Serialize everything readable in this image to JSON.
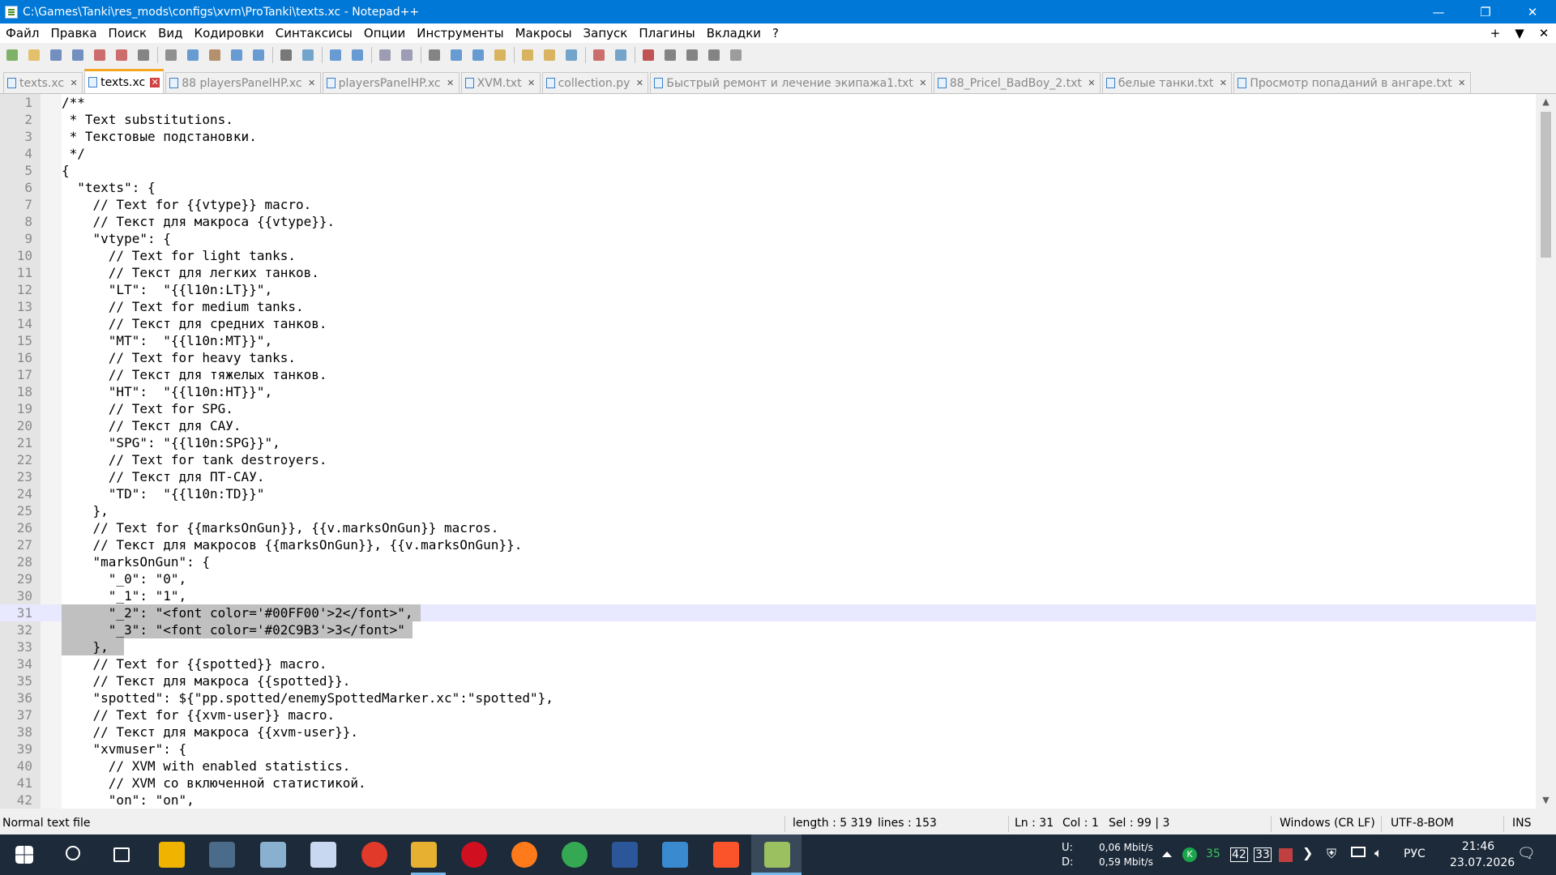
{
  "window": {
    "title": "C:\\Games\\Tanki\\res_mods\\configs\\xvm\\ProTanki\\texts.xc - Notepad++",
    "minimize": "—",
    "maximize": "❐",
    "close": "✕"
  },
  "menu": {
    "items": [
      "Файл",
      "Правка",
      "Поиск",
      "Вид",
      "Кодировки",
      "Синтаксисы",
      "Опции",
      "Инструменты",
      "Макросы",
      "Запуск",
      "Плагины",
      "Вкладки",
      "?"
    ],
    "right": [
      "+",
      "▼",
      "✕"
    ]
  },
  "toolbar": {
    "icons": [
      "new-icon",
      "open-icon",
      "save-icon",
      "save-all-icon",
      "close-icon",
      "close-all-icon",
      "print-icon",
      "cut-icon",
      "copy-icon",
      "paste-icon",
      "undo-icon",
      "redo-icon",
      "find-icon",
      "replace-icon",
      "zoom-in-icon",
      "zoom-out-icon",
      "sync-v-icon",
      "sync-h-icon",
      "wrap-icon",
      "all-chars-icon",
      "indent-guide-icon",
      "doc-map-icon",
      "function-list-icon",
      "folder-workspace-icon",
      "doc-list-icon",
      "monitor-icon",
      "eye-icon",
      "record-icon",
      "stop-icon",
      "play-icon",
      "run-multiple-icon",
      "save-macro-icon"
    ]
  },
  "tabs": [
    {
      "label": "texts.xc",
      "active": false
    },
    {
      "label": "texts.xc",
      "active": true
    },
    {
      "label": "88 playersPanelHP.xc",
      "active": false
    },
    {
      "label": "playersPanelHP.xc",
      "active": false
    },
    {
      "label": "XVM.txt",
      "active": false
    },
    {
      "label": "collection.py",
      "active": false
    },
    {
      "label": "Быстрый ремонт и лечение экипажа1.txt",
      "active": false
    },
    {
      "label": "88_Pricel_BadBoy_2.txt",
      "active": false
    },
    {
      "label": "белые танки.txt",
      "active": false
    },
    {
      "label": "Просмотр попаданий в ангаре.txt",
      "active": false
    }
  ],
  "editor": {
    "lines": [
      "/**",
      " * Text substitutions.",
      " * Текстовые подстановки.",
      " */",
      "{",
      "  \"texts\": {",
      "    // Text for {{vtype}} macro.",
      "    // Текст для макроса {{vtype}}.",
      "    \"vtype\": {",
      "      // Text for light tanks.",
      "      // Текст для легких танков.",
      "      \"LT\":  \"{{l10n:LT}}\",",
      "      // Text for medium tanks.",
      "      // Текст для средних танков.",
      "      \"MT\":  \"{{l10n:MT}}\",",
      "      // Text for heavy tanks.",
      "      // Текст для тяжелых танков.",
      "      \"HT\":  \"{{l10n:HT}}\",",
      "      // Text for SPG.",
      "      // Текст для САУ.",
      "      \"SPG\": \"{{l10n:SPG}}\",",
      "      // Text for tank destroyers.",
      "      // Текст для ПТ-САУ.",
      "      \"TD\":  \"{{l10n:TD}}\"",
      "    },",
      "    // Text for {{marksOnGun}}, {{v.marksOnGun}} macros.",
      "    // Текст для макросов {{marksOnGun}}, {{v.marksOnGun}}.",
      "    \"marksOnGun\": {",
      "      \"_0\": \"0\",",
      "      \"_1\": \"1\",",
      "      \"_2\": \"<font color='#00FF00'>2</font>\",",
      "      \"_3\": \"<font color='#02C9B3'>3</font>\"",
      "    },",
      "    // Text for {{spotted}} macro.",
      "    // Текст для макроса {{spotted}}.",
      "    \"spotted\": ${\"pp.spotted/enemySpottedMarker.xc\":\"spotted\"},",
      "    // Text for {{xvm-user}} macro.",
      "    // Текст для макроса {{xvm-user}}.",
      "    \"xvmuser\": {",
      "      // XVM with enabled statistics.",
      "      // XVM со включенной статистикой.",
      "      \"on\": \"on\","
    ],
    "selected_lines": [
      31,
      32,
      33
    ],
    "caret_line": 31
  },
  "status": {
    "file_type": "Normal text file",
    "length": "length : 5 319",
    "lines": "lines : 153",
    "ln": "Ln : 31",
    "col": "Col : 1",
    "sel": "Sel : 99 | 3",
    "eol": "Windows (CR LF)",
    "encoding": "UTF-8-BOM",
    "mode": "INS"
  },
  "taskbar": {
    "apps": [
      "start-icon",
      "search-icon",
      "task-view-icon",
      "warning-app-icon",
      "explorer-window-icon",
      "ide-icon",
      "notepad-icon",
      "yandex-browser-icon",
      "folder-icon",
      "opera-icon",
      "firefox-icon",
      "chrome-icon",
      "word-icon",
      "game-launcher-icon",
      "brave-icon",
      "notepadpp-icon"
    ],
    "net_up_label": "U:",
    "net_down_label": "D:",
    "net_up": "0,06 Mbit/s",
    "net_down": "0,59 Mbit/s",
    "tray_num1": "35",
    "tray_num2": "42",
    "tray_num3": "33",
    "lang": "РУС",
    "time": "21:46",
    "date": "23.07.2026"
  }
}
